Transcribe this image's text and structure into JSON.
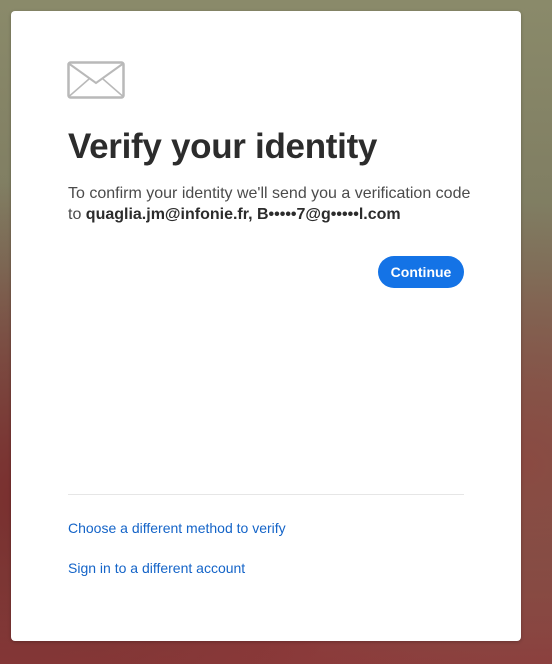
{
  "card": {
    "icon": "mail-envelope-icon",
    "title": "Verify your identity",
    "description_prefix": "To confirm your identity we'll send you a verification code to ",
    "recipients": "quaglia.jm@infonie.fr, B•••••7@g•••••l.com",
    "continue_label": "Continue"
  },
  "links": {
    "different_method": "Choose a different method to verify",
    "different_account": "Sign in to a different account"
  },
  "colors": {
    "accent": "#1473e6",
    "link": "#1464c8",
    "title": "#2c2c2c"
  }
}
